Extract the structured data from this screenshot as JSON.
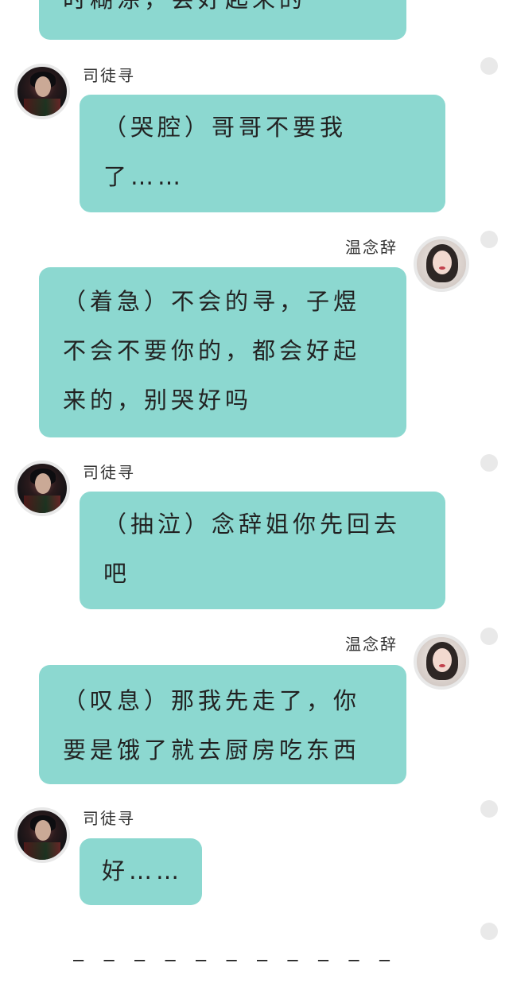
{
  "messages": [
    {
      "speaker": "",
      "text": "时糊涂，会好起来的"
    },
    {
      "speaker": "司徒寻",
      "text": "（哭腔）哥哥不要我了……"
    },
    {
      "speaker": "温念辞",
      "text": "（着急）不会的寻，子煜不会不要你的，都会好起来的，别哭好吗"
    },
    {
      "speaker": "司徒寻",
      "text": "（抽泣）念辞姐你先回去吧"
    },
    {
      "speaker": "温念辞",
      "text": "（叹息）那我先走了，你要是饿了就去厨房吃东西"
    },
    {
      "speaker": "司徒寻",
      "text": "好……"
    }
  ],
  "divider": "— — — — — — — — — — —"
}
